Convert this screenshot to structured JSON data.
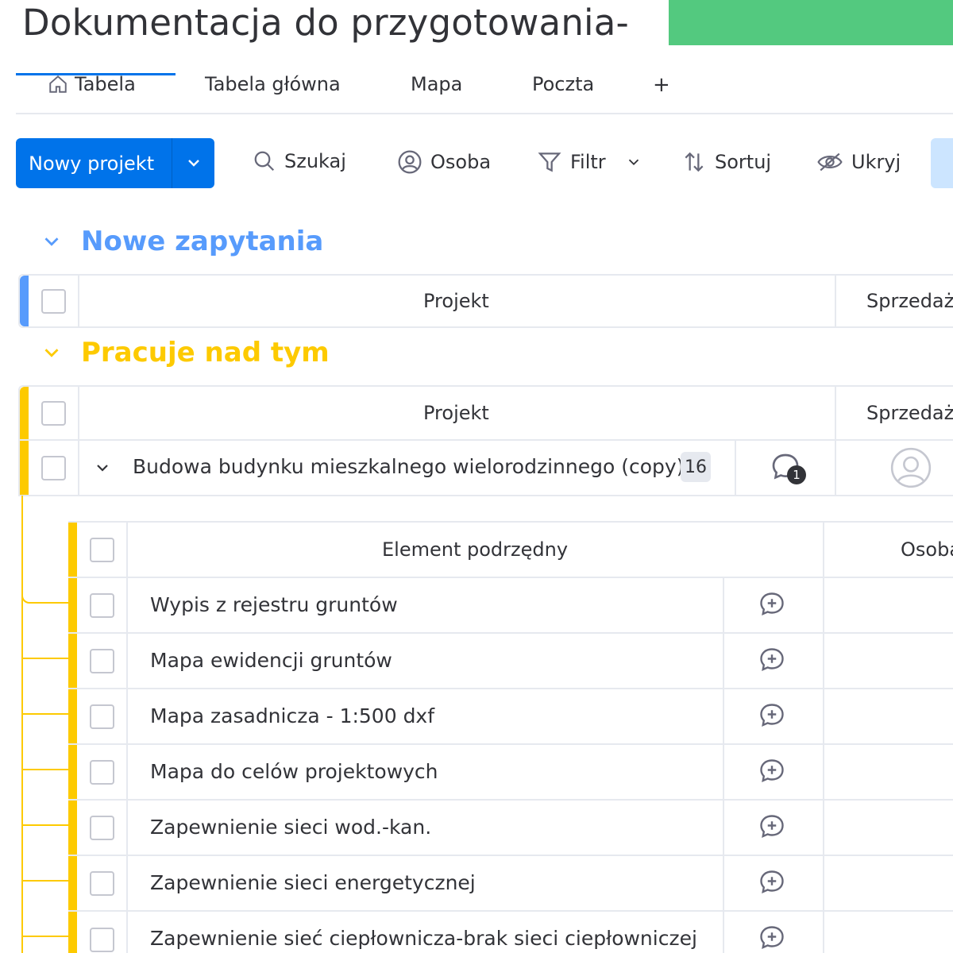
{
  "header": {
    "title": "Dokumentacja do przygotowania-"
  },
  "tabs": [
    {
      "label": "Tabela",
      "icon": "home-icon"
    },
    {
      "label": "Tabela główna"
    },
    {
      "label": "Mapa"
    },
    {
      "label": "Poczta"
    },
    {
      "label": "+"
    }
  ],
  "toolbar": {
    "new_project": "Nowy projekt",
    "search": "Szukaj",
    "person": "Osoba",
    "filter": "Filtr",
    "sort": "Sortuj",
    "hide": "Ukryj"
  },
  "groups": [
    {
      "title": "Nowe zapytania",
      "color": "#579bfc",
      "columns": {
        "project": "Projekt",
        "sales": "Sprzedaż"
      }
    },
    {
      "title": "Pracuje nad tym",
      "color": "#fdca00",
      "columns": {
        "project": "Projekt",
        "sales": "Sprzedaż"
      },
      "item": {
        "name": "Budowa budynku mieszkalnego wielorodzinnego (copy)",
        "subitem_count": "16",
        "update_count": "1"
      },
      "subitems": {
        "header": "Element podrzędny",
        "person_header": "Osoba",
        "rows": [
          "Wypis z rejestru gruntów",
          "Mapa ewidencji gruntów",
          "Mapa zasadnicza - 1:500 dxf",
          "Mapa do celów projektowych",
          "Zapewnienie sieci wod.-kan.",
          "Zapewnienie sieci energetycznej",
          "Zapewnienie sieć ciepłownicza-brak sieci ciepłowniczej"
        ]
      }
    }
  ]
}
